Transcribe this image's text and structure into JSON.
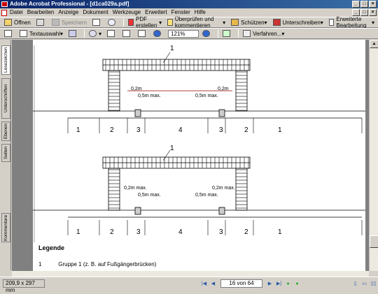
{
  "window": {
    "title": "Adobe Acrobat Professional - [d1ca029a.pdf]"
  },
  "menu": [
    "Datei",
    "Bearbeiten",
    "Anzeige",
    "Dokument",
    "Werkzeuge",
    "Erweitert",
    "Fenster",
    "Hilfe"
  ],
  "toolbar1": {
    "open": "Öffnen",
    "save": "Speichern",
    "create_pdf": "PDF erstellen",
    "review": "Überprüfen und kommentieren",
    "protect": "Schützen",
    "sign": "Unterschreiben",
    "advanced_edit": "Erweiterte Bearbeitung"
  },
  "toolbar2": {
    "text_select": "Textauswahl",
    "zoom": "121%",
    "procedures": "Verfahren..."
  },
  "side_tabs": [
    "Lesezeichen",
    "Unterschriften",
    "Ebenen",
    "Seiten",
    "Kommentare"
  ],
  "drawing": {
    "callout": "1",
    "top_labels": {
      "left_a": "0,2m",
      "left_b": "0,5m max.",
      "right_a": "0,5m max.",
      "right_b": "0,2m"
    },
    "bottom_labels": {
      "left_a": "0,2m max.",
      "left_b": "0,5m max.",
      "right_a": "0,5m max.",
      "right_b": "0,2m max."
    },
    "zones": [
      "1",
      "2",
      "3",
      "4",
      "3",
      "2",
      "1"
    ]
  },
  "legend": {
    "title": "Legende",
    "rows": [
      {
        "num": "1",
        "text": "Gruppe 1 (z. B. auf Fußgängerbrücken)"
      }
    ]
  },
  "status": {
    "page_size": "209,9 x 297 mm",
    "page_indicator": "16 von 64"
  },
  "colors": {
    "titlebar": "#0a246a",
    "redline": "#a52a2a"
  }
}
